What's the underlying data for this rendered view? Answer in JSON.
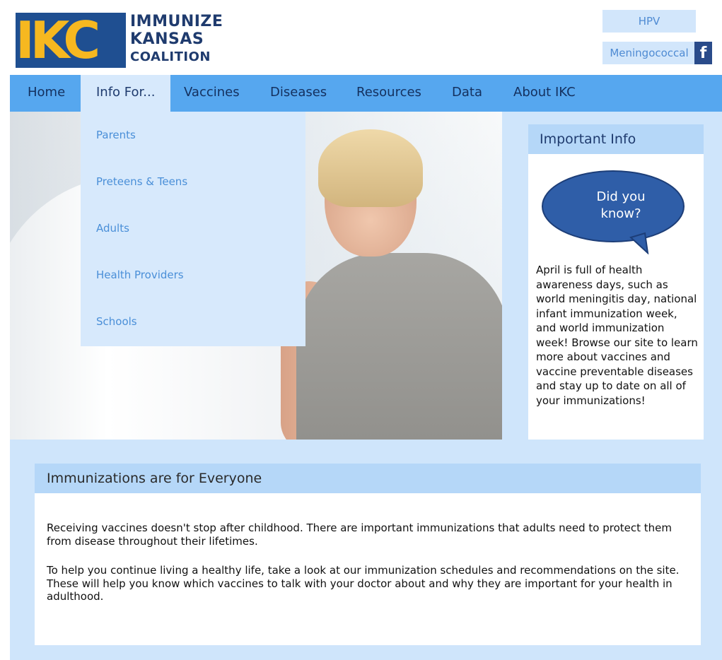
{
  "logo": {
    "letters": "IKC",
    "line1": "IMMUNIZE",
    "line2": "KANSAS",
    "line3": "COALITION"
  },
  "top_links": [
    {
      "label": "HPV"
    },
    {
      "label": "Meningococcal"
    }
  ],
  "facebook_icon": "f",
  "nav": {
    "items": [
      {
        "label": "Home"
      },
      {
        "label": "Info For..."
      },
      {
        "label": "Vaccines"
      },
      {
        "label": "Diseases"
      },
      {
        "label": "Resources"
      },
      {
        "label": "Data"
      },
      {
        "label": "About IKC"
      }
    ],
    "active": "Info For..."
  },
  "dropdown": {
    "items": [
      {
        "label": "Parents"
      },
      {
        "label": "Preteens & Teens"
      },
      {
        "label": "Adults"
      },
      {
        "label": "Health Providers"
      },
      {
        "label": "Schools"
      }
    ]
  },
  "sidebar": {
    "title": "Important Info",
    "bubble_line1": "Did you",
    "bubble_line2": "know?",
    "text": "April is full of health awareness days, such as world meningitis day, national infant immunization week, and world immunization week! Browse our site to learn more about vaccines and vaccine preventable diseases and stay up to date on all of your immunizations!"
  },
  "main": {
    "title": "Immunizations are for Everyone",
    "paragraph1": "Receiving vaccines doesn't stop after childhood. There are important immunizations that adults need to protect them from disease throughout their lifetimes.",
    "paragraph2": "To help you continue living a healthy life, take a look at our immunization schedules and recommendations on the site. These will help you know which vaccines to talk with your doctor about and why they are important for your health in adulthood."
  },
  "colors": {
    "nav_bg": "#56a7ef",
    "dropdown_bg": "#d7e9fc",
    "page_bg": "#cfe5fb",
    "header_bar": "#b5d7f8",
    "logo_blue": "#1f4f91",
    "logo_yellow": "#f6b820",
    "bubble": "#2f5ea8"
  }
}
